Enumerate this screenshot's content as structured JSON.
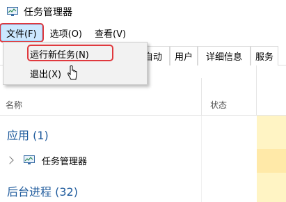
{
  "window": {
    "title": "任务管理器"
  },
  "menu": {
    "file": "文件(F)",
    "options": "选项(O)",
    "view": "查看(V)"
  },
  "dropdown": {
    "run_new_task": "运行新任务(N)",
    "exit": "退出(X)"
  },
  "tabs": {
    "startup_fragment": "自动",
    "users": "用户",
    "details": "详细信息",
    "services": "服务"
  },
  "columns": {
    "name": "名称",
    "status": "状态"
  },
  "groups": {
    "apps": "应用 (1)",
    "background": "后台进程 (32)"
  },
  "rows": {
    "app_item": "任务管理器"
  },
  "colors": {
    "highlight_border": "#e0393e",
    "group_text": "#1e5a9c",
    "menu_active_bg": "#cce8ff"
  }
}
